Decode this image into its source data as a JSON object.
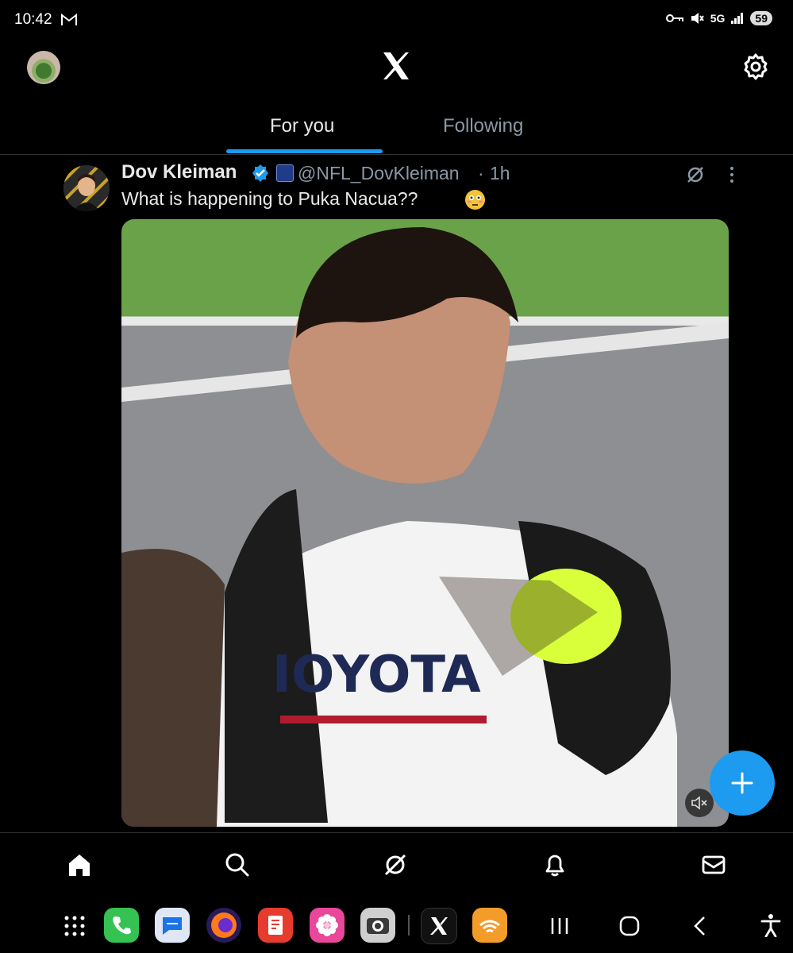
{
  "status_bar": {
    "time": "10:42",
    "network": "5G",
    "battery": "59"
  },
  "header": {
    "logo": "x-logo"
  },
  "tabs": [
    {
      "label": "For you",
      "active": true
    },
    {
      "label": "Following",
      "active": false
    }
  ],
  "post": {
    "author_name": "Dov Kleiman",
    "handle": "@NFL_DovKleiman",
    "separator": "·",
    "time": "1h",
    "text": "What is happening to Puka Nacua??",
    "emoji": "😳"
  },
  "colors": {
    "accent": "#1d9bf0",
    "text_primary": "#e7e9ea",
    "text_secondary": "#8b98a5",
    "background": "#000000"
  },
  "bottom_nav": [
    "home-icon",
    "search-icon",
    "grok-icon",
    "notifications-icon",
    "messages-icon"
  ],
  "dock": [
    "apps-grid-icon",
    "phone-app",
    "messages-app",
    "firefox-app",
    "notes-app",
    "gallery-app",
    "camera-app",
    "x-app",
    "audible-app",
    "recents-icon",
    "home-button-icon",
    "back-icon",
    "accessibility-icon"
  ]
}
